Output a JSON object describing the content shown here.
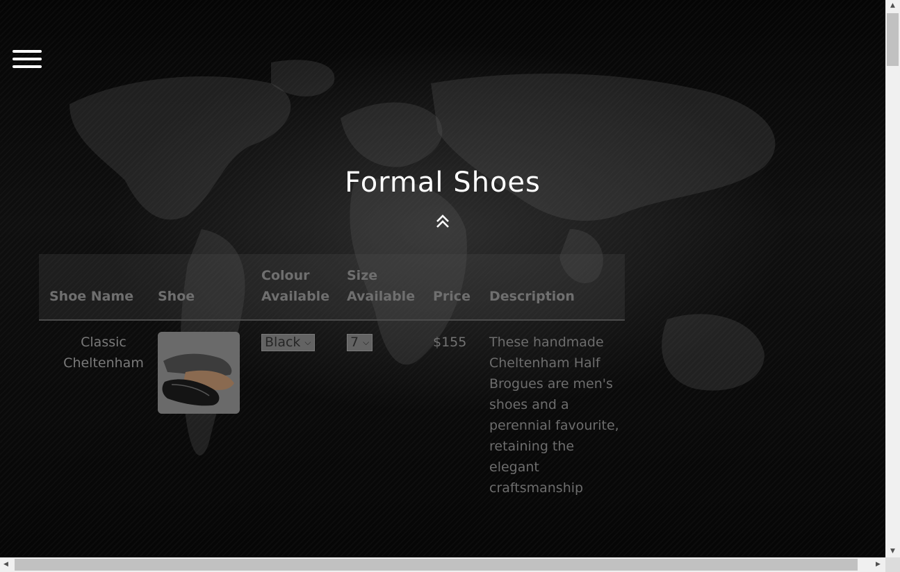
{
  "page": {
    "title": "Formal Shoes"
  },
  "icons": {
    "menu": "hamburger-menu-icon",
    "scroll_up": "double-chevron-up-icon"
  },
  "table": {
    "headers": {
      "name": "Shoe Name",
      "shoe": "Shoe",
      "colour": "Colour Available",
      "size": "Size Available",
      "price": "Price",
      "description": "Description"
    },
    "rows": [
      {
        "name": "Classic Cheltenham",
        "colour_selected": "Black",
        "size_selected": "7",
        "price": "$155",
        "description": "These handmade Cheltenham Half Brogues are men's shoes and a perennial favourite, retaining the elegant craftsmanship"
      }
    ]
  },
  "colors": {
    "title": "#ffffff",
    "text_dim": "#737373",
    "background": "#0a0a0a"
  }
}
